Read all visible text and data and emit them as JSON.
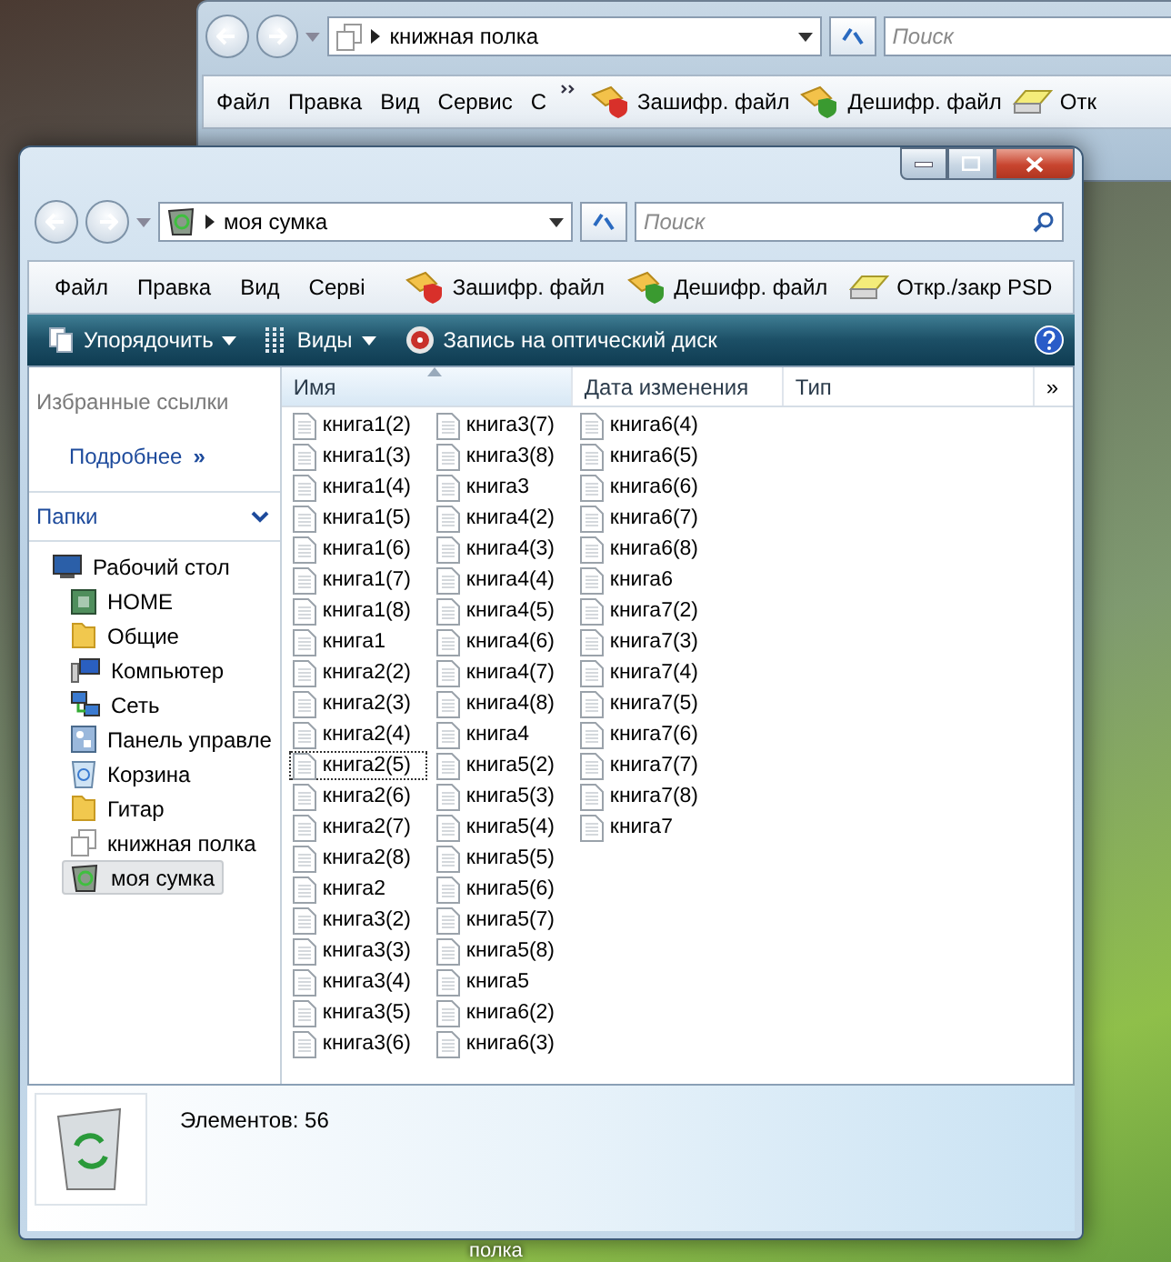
{
  "back_window": {
    "address": "книжная полка",
    "search": {
      "placeholder": "Поиск"
    },
    "menu": [
      "Файл",
      "Правка",
      "Вид",
      "Сервис",
      "С"
    ],
    "tools": [
      {
        "kind": "encrypt",
        "label": "Зашифр. файл"
      },
      {
        "kind": "decrypt",
        "label": "Дешифр. файл"
      },
      {
        "kind": "disk",
        "label": "Отк"
      }
    ]
  },
  "window": {
    "address": "моя сумка",
    "search": {
      "placeholder": "Поиск"
    },
    "menu": [
      "Файл",
      "Правка",
      "Вид",
      "Серві"
    ],
    "tools": [
      {
        "kind": "encrypt",
        "label": "Зашифр. файл"
      },
      {
        "kind": "decrypt",
        "label": "Дешифр. файл"
      },
      {
        "kind": "disk",
        "label": "Откр./закр PSD"
      }
    ],
    "commands": [
      {
        "kind": "organize",
        "label": "Упорядочить",
        "dropdown": true
      },
      {
        "kind": "views",
        "label": "Виды",
        "dropdown": true
      },
      {
        "kind": "burn",
        "label": "Запись на оптический диск",
        "dropdown": false
      }
    ],
    "favorites": {
      "title": "Избранные ссылки",
      "more": "Подробнее",
      "more_icon": "»"
    },
    "folders": {
      "title": "Папки",
      "tree": [
        {
          "label": "Рабочий стол",
          "kind": "desktop",
          "selected": false,
          "children": [
            {
              "label": "HOME",
              "kind": "home",
              "selected": false
            },
            {
              "label": "Общие",
              "kind": "folder",
              "selected": false
            },
            {
              "label": "Компьютер",
              "kind": "computer",
              "selected": false
            },
            {
              "label": "Сеть",
              "kind": "network",
              "selected": false
            },
            {
              "label": "Панель управле",
              "kind": "control",
              "selected": false
            },
            {
              "label": "Корзина",
              "kind": "bin",
              "selected": false
            },
            {
              "label": "Гитар",
              "kind": "folder",
              "selected": false
            },
            {
              "label": "книжная полка",
              "kind": "library",
              "selected": false
            },
            {
              "label": "моя сумка",
              "kind": "bag",
              "selected": true
            }
          ]
        }
      ]
    },
    "columns": [
      {
        "label": "Имя",
        "sorted": true
      },
      {
        "label": "Дата изменения",
        "sorted": false
      },
      {
        "label": "Тип",
        "sorted": false
      }
    ],
    "columns_more": "»",
    "files": [
      {
        "name": "книга1(2)",
        "focused": false
      },
      {
        "name": "книга1(3)",
        "focused": false
      },
      {
        "name": "книга1(4)",
        "focused": false
      },
      {
        "name": "книга1(5)",
        "focused": false
      },
      {
        "name": "книга1(6)",
        "focused": false
      },
      {
        "name": "книга1(7)",
        "focused": false
      },
      {
        "name": "книга1(8)",
        "focused": false
      },
      {
        "name": "книга1",
        "focused": false
      },
      {
        "name": "книга2(2)",
        "focused": false
      },
      {
        "name": "книга2(3)",
        "focused": false
      },
      {
        "name": "книга2(4)",
        "focused": false
      },
      {
        "name": "книга2(5)",
        "focused": true
      },
      {
        "name": "книга2(6)",
        "focused": false
      },
      {
        "name": "книга2(7)",
        "focused": false
      },
      {
        "name": "книга2(8)",
        "focused": false
      },
      {
        "name": "книга2",
        "focused": false
      },
      {
        "name": "книга3(2)",
        "focused": false
      },
      {
        "name": "книга3(3)",
        "focused": false
      },
      {
        "name": "книга3(4)",
        "focused": false
      },
      {
        "name": "книга3(5)",
        "focused": false
      },
      {
        "name": "книга3(6)",
        "focused": false
      },
      {
        "name": "книга3(7)",
        "focused": false
      },
      {
        "name": "книга3(8)",
        "focused": false
      },
      {
        "name": "книга3",
        "focused": false
      },
      {
        "name": "книга4(2)",
        "focused": false
      },
      {
        "name": "книга4(3)",
        "focused": false
      },
      {
        "name": "книга4(4)",
        "focused": false
      },
      {
        "name": "книга4(5)",
        "focused": false
      },
      {
        "name": "книга4(6)",
        "focused": false
      },
      {
        "name": "книга4(7)",
        "focused": false
      },
      {
        "name": "книга4(8)",
        "focused": false
      },
      {
        "name": "книга4",
        "focused": false
      },
      {
        "name": "книга5(2)",
        "focused": false
      },
      {
        "name": "книга5(3)",
        "focused": false
      },
      {
        "name": "книга5(4)",
        "focused": false
      },
      {
        "name": "книга5(5)",
        "focused": false
      },
      {
        "name": "книга5(6)",
        "focused": false
      },
      {
        "name": "книга5(7)",
        "focused": false
      },
      {
        "name": "книга5(8)",
        "focused": false
      },
      {
        "name": "книга5",
        "focused": false
      },
      {
        "name": "книга6(2)",
        "focused": false
      },
      {
        "name": "книга6(3)",
        "focused": false
      },
      {
        "name": "книга6(4)",
        "focused": false
      },
      {
        "name": "книга6(5)",
        "focused": false
      },
      {
        "name": "книга6(6)",
        "focused": false
      },
      {
        "name": "книга6(7)",
        "focused": false
      },
      {
        "name": "книга6(8)",
        "focused": false
      },
      {
        "name": "книга6",
        "focused": false
      },
      {
        "name": "книга7(2)",
        "focused": false
      },
      {
        "name": "книга7(3)",
        "focused": false
      },
      {
        "name": "книга7(4)",
        "focused": false
      },
      {
        "name": "книга7(5)",
        "focused": false
      },
      {
        "name": "книга7(6)",
        "focused": false
      },
      {
        "name": "книга7(7)",
        "focused": false
      },
      {
        "name": "книга7(8)",
        "focused": false
      },
      {
        "name": "книга7",
        "focused": false
      }
    ],
    "status": "Элементов: 56"
  },
  "desktop_labels": [
    "полка"
  ]
}
